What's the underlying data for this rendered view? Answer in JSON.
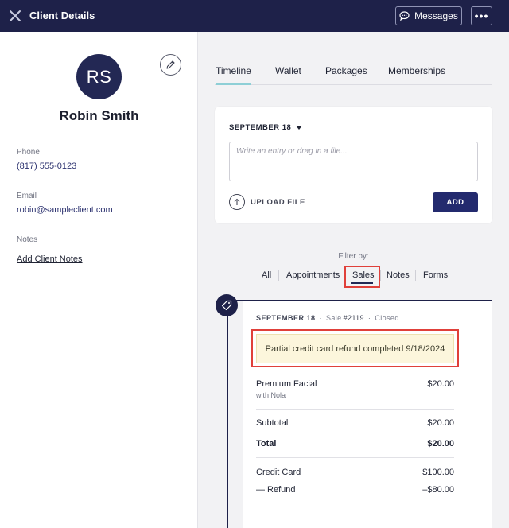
{
  "topbar": {
    "title": "Client Details",
    "messages_label": "Messages",
    "more_label": "•••"
  },
  "client": {
    "initials": "RS",
    "name": "Robin Smith",
    "phone_label": "Phone",
    "phone": "(817) 555-0123",
    "email_label": "Email",
    "email": "robin@sampleclient.com",
    "notes_label": "Notes",
    "notes_link": "Add Client Notes"
  },
  "tabs": [
    {
      "label": "Timeline",
      "active": true
    },
    {
      "label": "Wallet"
    },
    {
      "label": "Packages"
    },
    {
      "label": "Memberships"
    }
  ],
  "entry": {
    "date": "SEPTEMBER 18",
    "placeholder": "Write an entry or drag in a file...",
    "upload_label": "UPLOAD FILE",
    "add_label": "ADD"
  },
  "filter": {
    "label": "Filter by:",
    "items": [
      "All",
      "Appointments",
      "Sales",
      "Notes",
      "Forms"
    ],
    "selected": "Sales"
  },
  "sale": {
    "date": "SEPTEMBER 18",
    "sep": "·",
    "sale_prefix": "Sale",
    "number": "#2119",
    "status": "Closed",
    "notice": "Partial credit card refund completed 9/18/2024",
    "item_name": "Premium Facial",
    "item_staff": "with Nola",
    "item_price": "$20.00",
    "subtotal_label": "Subtotal",
    "subtotal": "$20.00",
    "total_label": "Total",
    "total": "$20.00",
    "payment_label": "Credit Card",
    "payment": "$100.00",
    "refund_label": "— Refund",
    "refund": "–$80.00"
  },
  "colors": {
    "header_bg": "#1e2149",
    "accent_teal": "#8ecfd6",
    "primary_button": "#232a6e",
    "highlight_red": "#e0403a",
    "notice_bg": "#fcf6dc"
  }
}
